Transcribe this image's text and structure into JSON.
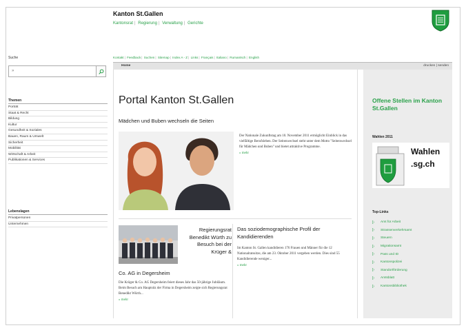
{
  "header": {
    "site_title": "Kanton St.Gallen",
    "main_nav": [
      "Kantonsrat",
      "Regierung",
      "Verwaltung",
      "Gerichte"
    ],
    "crest_icon": "st-gallen-crest"
  },
  "service_nav": [
    "Kontakt",
    "Feedback",
    "Suchen",
    "Sitemap",
    "Index A - Z",
    "Links",
    "Français",
    "Italiano",
    "Rumantsch",
    "English"
  ],
  "search": {
    "label": "Suche",
    "value": "»",
    "button_icon": "search-icon"
  },
  "sidebar": {
    "themen_heading": "Themen",
    "themen": [
      "Porträt",
      "Staat & Recht",
      "Bildung",
      "Kultur",
      "Gesundheit & Soziales",
      "Bauen, Raum & Umwelt",
      "Sicherheit",
      "Mobilität",
      "Wirtschaft & Arbeit",
      "Publikationen & Services"
    ],
    "lebenslagen_heading": "Lebenslagen",
    "lebenslagen": [
      "Privatpersonen",
      "Unternehmen"
    ]
  },
  "crumb_bar": {
    "home": "Home",
    "tools": "drucken | senden"
  },
  "main": {
    "page_title": "Portal Kanton St.Gallen",
    "lead_heading": "Mädchen und Buben wechseln die Seiten",
    "lead_text": "Der Nationale Zukunftstag am 10. November 2011 ermöglicht Einblick in das vielfältige Berufsleben. Der Seitenwechsel steht unter dem Motto \"Seitenwechsel für Mädchen und Buben\" und bietet attraktive Programme.",
    "more_label": "» mehr",
    "teaser1_title_right": "Regierungsrat Benedikt Würth zu Besuch bei der Krüger &",
    "teaser1_title_tail": "Co. AG in Degersheim",
    "teaser1_text": "Die Krüger & Co. AG Degersheim feiert dieses Jahr das 50-jährige Jubiläum. Beim Besuch am Hauptsitz der Firma in Degersheim zeigte sich Regierungsrat Benedikt Würth...",
    "teaser2_title": "Das soziodemographische Profil der Kandidierenden",
    "teaser2_text": "Im Kanton St. Gallen kandidieren 176 Frauen und Männer für die 12 Nationalratssitze, die am 23. Oktober 2011 vergeben werden. Dies sind 55 Kandidierende weniger..."
  },
  "right": {
    "jobs_title": "Offene Stellen im Kanton St.Gallen",
    "wahlen_heading": "Wahlen 2011",
    "wahlen_line1": "Wahlen",
    "wahlen_line2": ".sg.ch",
    "toplinks_heading": "Top-Links",
    "toplinks": [
      "Amt für Arbeit",
      "Strassenverkehrsamt",
      "Steuern",
      "Migrationsamt",
      "Pass und ID",
      "Kantonspolizei",
      "Standortförderung",
      "Amtsblatt",
      "Kantonsbibliothek"
    ]
  },
  "colors": {
    "accent_green": "#2aa14a",
    "crest_green": "#1f9d3f",
    "sidebar_gray": "#ececec"
  }
}
